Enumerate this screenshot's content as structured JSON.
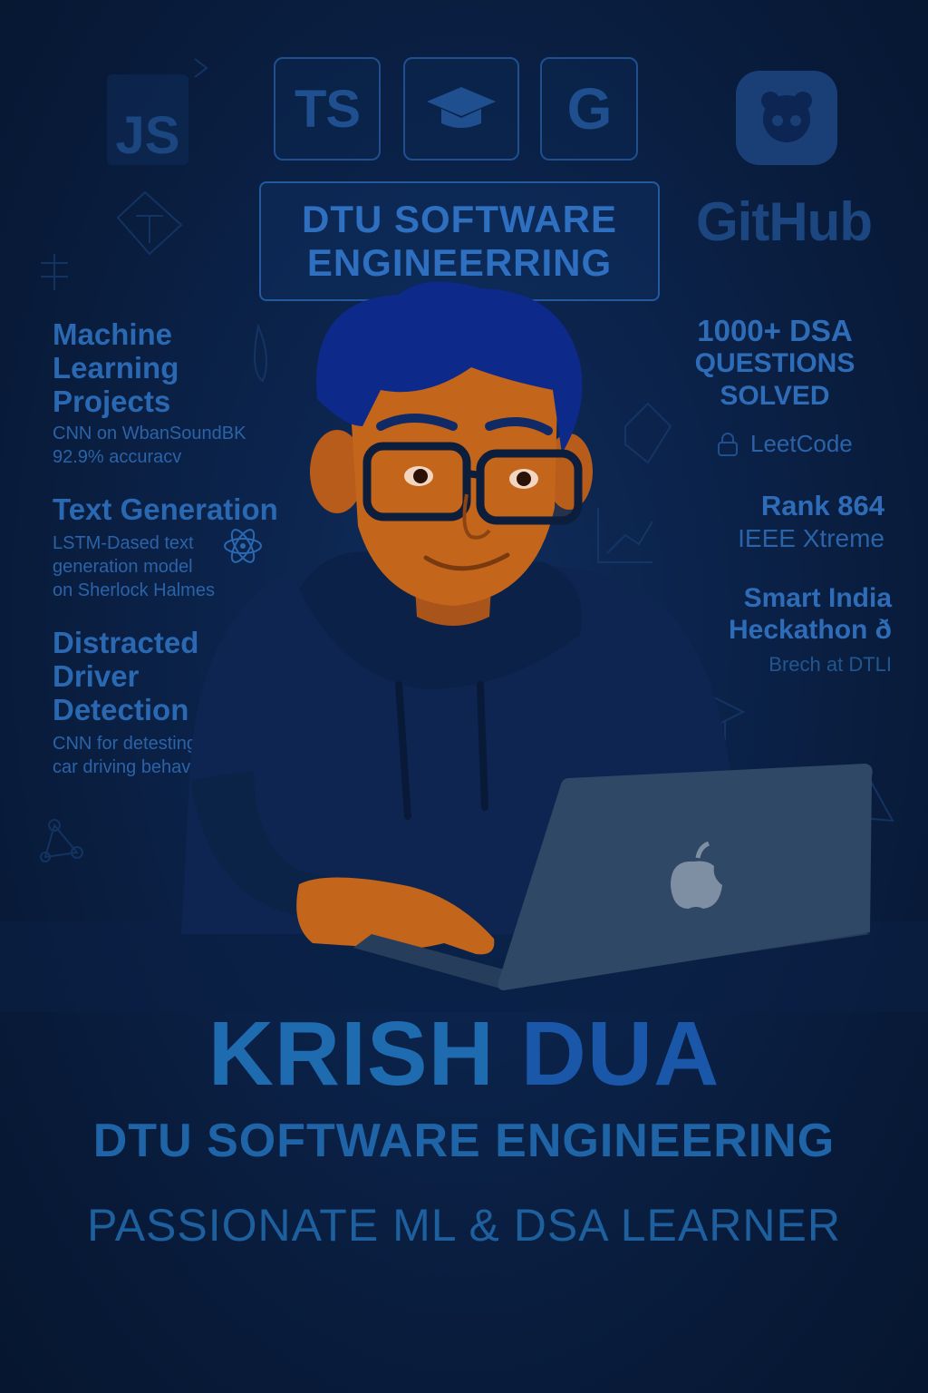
{
  "icons": {
    "js_label": "JS",
    "ts_label": "TS",
    "g_label": "G",
    "github_label": "GitHub"
  },
  "banner": {
    "line1": "DTU SOFTWARE",
    "line2": "ENGINEERRING"
  },
  "projects": [
    {
      "title_lines": [
        "Machine",
        "Learning",
        "Projects"
      ],
      "desc_lines": [
        "CNN on WbanSoundBK",
        "92.9% accuracv"
      ]
    },
    {
      "title_lines": [
        "Text Generation"
      ],
      "desc_lines": [
        "LSTM-Dased text",
        "generation model",
        "on Sherlock Halmes"
      ]
    },
    {
      "title_lines": [
        "Distracted",
        "Driver",
        "Detection"
      ],
      "desc_lines": [
        "CNN for detestingin©",
        "car driving behaviors"
      ]
    }
  ],
  "achievements": {
    "dsa": {
      "line1": "1000+ DSA",
      "line2": "QUESTIONS",
      "line3": "SOLVED"
    },
    "leetcode": "LeetCode",
    "ieee": {
      "rank": "Rank 864",
      "event": "IEEE Xtreme"
    },
    "sih": {
      "line1": "Smart India",
      "line2": "Heckathon ð",
      "line3": "Brech at DTLI"
    }
  },
  "hero": {
    "name_first": "KRISH",
    "name_last": "DUA",
    "subtitle": "DTU SOFTWARE ENGINEERING",
    "tagline": "PASSIONATE ML & DSA LEARNER"
  },
  "colors": {
    "background": "#0b2249",
    "accent": "#2a68b2",
    "name_first": "#1f6bb0",
    "name_last": "#1a57a8",
    "skin": "#c4651c",
    "hoodie": "#0d2550",
    "laptop": "#2f4866"
  }
}
